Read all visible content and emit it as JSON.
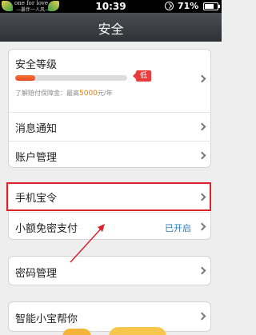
{
  "status_bar": {
    "carrier_line1": "one for love",
    "carrier_line2": "—暴伴一人风—",
    "time": "10:39",
    "battery_percent": "71%",
    "battery_level": 0.71
  },
  "nav": {
    "title": "安全"
  },
  "security_card": {
    "level_label": "安全等级",
    "progress_fraction": 0.18,
    "level_badge": "低",
    "guarantee_prefix": "了解赔付保障金：最高",
    "guarantee_amount": "5000",
    "guarantee_suffix": "元/年",
    "notifications_label": "消息通知",
    "account_label": "账户管理"
  },
  "token_card": {
    "phone_token_label": "手机宝令",
    "small_pay_label": "小额免密支付",
    "small_pay_status": "已开启"
  },
  "password_card": {
    "password_label": "密码管理"
  },
  "helper_card": {
    "helper_label": "智能小宝帮你"
  },
  "colors": {
    "highlight": "#d9242c",
    "badge": "#e83c3c",
    "accent_link": "#2a7ac2",
    "amount": "#f07a00"
  }
}
